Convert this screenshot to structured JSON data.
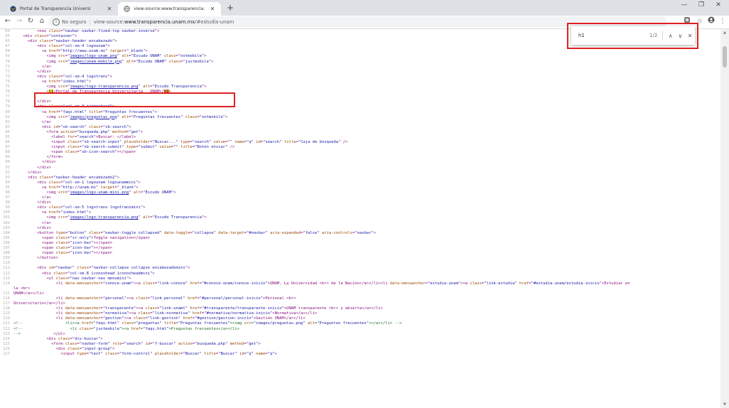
{
  "browser": {
    "tabs": [
      {
        "title": "Portal de Transparencia Universi",
        "active": false,
        "icon": "unam-favicon"
      },
      {
        "title": "view-source:www.transparencia.",
        "active": true,
        "icon": "globe-icon"
      }
    ],
    "new_tab_glyph": "+",
    "window_controls": {
      "minimize": "—",
      "restore": "❐",
      "close": "✕"
    },
    "address": {
      "security_label": "No seguro",
      "separator": "|",
      "url_prefix": "view-source:",
      "url_domain": "www.transparencia.unam.mx",
      "url_suffix": "/#estudia-unam"
    }
  },
  "find_bar": {
    "query": "h1",
    "count": "1/2"
  },
  "colors": {
    "tag": "#881280",
    "attribute": "#994500",
    "value": "#1a1aa6",
    "comment": "#236e25",
    "annotation": "#e02020",
    "match_current": "#ff9632",
    "match_other": "#ffff00"
  },
  "source": {
    "lines": [
      {
        "n": "64",
        "html": "          &lt;nav class=\"navbar navbar-fixed-top navbar-inverse\"&gt;"
      },
      {
        "n": "65",
        "html": "    &lt;div class=\"container\"&gt;"
      },
      {
        "n": "66",
        "html": "      &lt;div class=\"navbar-header encabezado\"&gt;"
      },
      {
        "n": "67",
        "html": "          &lt;div class=\"col-sm-4 logounam\"&gt;"
      },
      {
        "n": "68",
        "html": "            &lt;a href=\"http://www.unam.mx\" target=\"_blank\"&gt;"
      },
      {
        "n": "69",
        "html": "              &lt;img src=\"<u>images/logo-unam.png</u>\" alt=\"Escudo UNAM\" class=\"notmobile\"&gt;"
      },
      {
        "n": "70",
        "html": "              &lt;img src=\"<u>images/unam-mobile.png</u>\" alt=\"Escudo UNAM\" class=\"justmobile\"&gt;"
      },
      {
        "n": "71",
        "html": "            &lt;/a&gt;"
      },
      {
        "n": "72",
        "html": "          &lt;/div&gt;"
      },
      {
        "n": "73",
        "html": "          &lt;div class=\"col-sm-4 logotrans\"&gt;"
      },
      {
        "n": "74",
        "html": "            &lt;a href=\"index.html\"&gt;"
      },
      {
        "n": "75",
        "html": "              &lt;img src=\"<u>images/logo-transparencia.png</u>\" alt=\"Escudo Transparencia\"&gt;"
      },
      {
        "n": "76",
        "html": "              &lt;<span class='hl2'>h1</span>&gt;Portal de Transparencia Universitaria - UNAM&lt;/<span class='hl'>h1</span>&gt;"
      },
      {
        "n": "77",
        "html": ""
      },
      {
        "n": "78",
        "html": "          &lt;/div&gt;"
      },
      {
        "n": "79",
        "html": "          &lt;div class=\"col-sm-3 iconoshead\"&gt;"
      },
      {
        "n": "80",
        "html": "            &lt;a href=\"faqs.html\" title=\"Preguntas frecuentes\"&gt;"
      },
      {
        "n": "81",
        "html": "              &lt;img src=\"<u>images/preguntas.png</u>\" alt=\"Preguntas frecuentes\" class=\"notmobile\"&gt;"
      },
      {
        "n": "82",
        "html": "            &lt;/a&gt;"
      },
      {
        "n": "83",
        "html": "            &lt;div id=\"sb-search\" class=\"sb-search\"&gt;"
      },
      {
        "n": "84",
        "html": "              &lt;form action=\"busqueda.php\" method=\"get\"&gt;"
      },
      {
        "n": "85",
        "html": "                &lt;label for=\"search\"&gt;Buscar: &lt;/label&gt;"
      },
      {
        "n": "86",
        "html": "                &lt;input class=\"sb-search-input\" placeholder=\"Buscar...\" type=\"search\" value=\"\" name=\"q\" id=\"search\" title=\"Caja de búsqueda\" /&gt;"
      },
      {
        "n": "87",
        "html": "                &lt;input class=\"sb-search-submit\" type=\"submit\" value=\"\" title=\"Botón enviar\" /&gt;"
      },
      {
        "n": "88",
        "html": "                &lt;span class=\"sb-icon-search\"&gt;&lt;/span&gt;"
      },
      {
        "n": "89",
        "html": "              &lt;/form&gt;"
      },
      {
        "n": "90",
        "html": "            &lt;/div&gt;"
      },
      {
        "n": "91",
        "html": "          &lt;/div&gt;"
      },
      {
        "n": "92",
        "html": "      &lt;/div&gt;"
      },
      {
        "n": "93",
        "html": "      &lt;div class=\"navbar-header encabezado2\"&gt;"
      },
      {
        "n": "94",
        "html": "          &lt;div class=\"col-sm-1 logounam logounammini\"&gt;"
      },
      {
        "n": "95",
        "html": "            &lt;a href=\"http://unam.mx\" target=\"_blank\"&gt;"
      },
      {
        "n": "96",
        "html": "              &lt;img src=\"<u>images/logo-unam-mini.png</u>\" alt=\"Escudo UNAM\"&gt;"
      },
      {
        "n": "97",
        "html": "            &lt;/a&gt;"
      },
      {
        "n": "98",
        "html": "          &lt;/div&gt;"
      },
      {
        "n": "99",
        "html": "          &lt;div class=\"col-sm-5 logotrans logotransmini\"&gt;"
      },
      {
        "n": "100",
        "html": "            &lt;a href=\"index.html\"&gt;"
      },
      {
        "n": "101",
        "html": "              &lt;img src=\"<u>images/logo-transparencia.png</u>\" alt=\"Escudo Transparencia\"&gt;"
      },
      {
        "n": "102",
        "html": "            &lt;/a&gt;"
      },
      {
        "n": "103",
        "html": "          &lt;/div&gt;"
      },
      {
        "n": "104",
        "html": "          &lt;button type=\"button\" class=\"navbar-toggle collapsed\" data-toggle=\"collapse\" data-target=\"#navbar\" aria-expanded=\"false\" aria-controls=\"navbar\"&gt;"
      },
      {
        "n": "105",
        "html": "            &lt;span class=\"sr-only\"&gt;Toggle navigation&lt;/span&gt;"
      },
      {
        "n": "106",
        "html": "            &lt;span class=\"icon-bar\"&gt;&lt;/span&gt;"
      },
      {
        "n": "107",
        "html": "            &lt;span class=\"icon-bar\"&gt;&lt;/span&gt;"
      },
      {
        "n": "108",
        "html": "            &lt;span class=\"icon-bar\"&gt;&lt;/span&gt;"
      },
      {
        "n": "109",
        "html": "          &lt;/button&gt;"
      },
      {
        "n": "110",
        "html": ""
      },
      {
        "n": "111",
        "html": "          &lt;div id=\"navbar\" class=\"navbar-collapse collapse encabezadomini\"&gt;"
      },
      {
        "n": "112",
        "html": "            &lt;div class=\"col-sm-8 iconoshead iconosheadmini\"&gt;"
      },
      {
        "n": "113",
        "html": "              &lt;ul class=\"nav navbar-nav menumini\"&gt;"
      },
      {
        "n": "114",
        "html": "                  &lt;li data-menuanchor=\"conoce-unam\"&gt;&lt;a class=\"link-conoce\" href=\"#conoce-unam/conoce-inicio\"&gt;UNAM, La Universidad &lt;br&gt; de la Nación&lt;/a&gt;&lt;/li&gt;&lt;li data-menuanchor=\"estudia-unam\"&gt;&lt;a class=\"link-estudia\" href=\"#estudia-unam/estudia-inicio\"&gt;Estudiar en"
      },
      {
        "n": "",
        "html": "la &lt;br&gt;"
      },
      {
        "n": "115",
        "html": "UNAM&lt;/a&gt;&lt;/li&gt;"
      },
      {
        "n": "116",
        "html": "                  &lt;li data-menuanchor=\"personal\"&gt;&lt;a class=\"link-personal\" href=\"#personal/personal-inicio\"&gt;Personal &lt;br&gt;"
      },
      {
        "n": "117",
        "html": "Universitario&lt;/a&gt;&lt;/li&gt;"
      },
      {
        "n": "118",
        "html": "                  &lt;li data-menuanchor=\"transparente\"&gt;&lt;a class=\"link-unamt\" href=\"#transparente/transparente-inicio\"&gt;UNAM transparente &lt;br&gt; y abierta&lt;/a&gt;&lt;/li&gt;"
      },
      {
        "n": "119",
        "html": "                  &lt;li data-menuanchor=\"normativa\"&gt;&lt;a class=\"link-normativa\" href=\"#normativa/normativa-inicio\"&gt;Normativa&lt;/a&gt;&lt;/li&gt;"
      },
      {
        "n": "120",
        "html": "                  &lt;li data-menuanchor=\"gestion\"&gt;&lt;a class=\"link-gestion\" href=\"#gestion/gestion-inicio\"&gt;Gestión UNAM&lt;/a&gt;&lt;/li&gt;"
      },
      {
        "n": "121",
        "html": "<span class='cmt'>&lt;!--                  &lt;li&gt;&lt;a href=\"faqs.html\" class=\"preguntas\" title=\"Preguntas frecuentes\"&gt;&lt;img src=\"images/preguntas.png\" alt=\"Preguntas frecuentes\"&gt;&lt;/a&gt;&lt;/li&gt; --&gt;</span>"
      },
      {
        "n": "122",
        "html": "<span class='cmt'>&lt;!--                    &lt;li class=\"justmobile\"&gt;&lt;a href=\"faqs.html\"&gt;Preguntas frecuentes&lt;/a&gt;&lt;/li&gt;</span>"
      },
      {
        "n": "123",
        "html": "<span class='cmt'>--&gt;</span>              &lt;/ul&gt;"
      },
      {
        "n": "124",
        "html": "              &lt;div class=\"div-buscar\"&gt;"
      },
      {
        "n": "125",
        "html": "                &lt;form class=\"navbar-form\" role=\"search\" id=\"f-buscar\" action=\"busqueda.php\" method=\"get\"&gt;"
      },
      {
        "n": "126",
        "html": "                  &lt;div class=\"input-group\"&gt;"
      },
      {
        "n": "127",
        "html": "                    &lt;input type=\"text\" class=\"form-control\" placeholder=\"Buscar\" title=\"Buscar\" id=\"q\" name=\"q\"&gt;"
      }
    ]
  }
}
